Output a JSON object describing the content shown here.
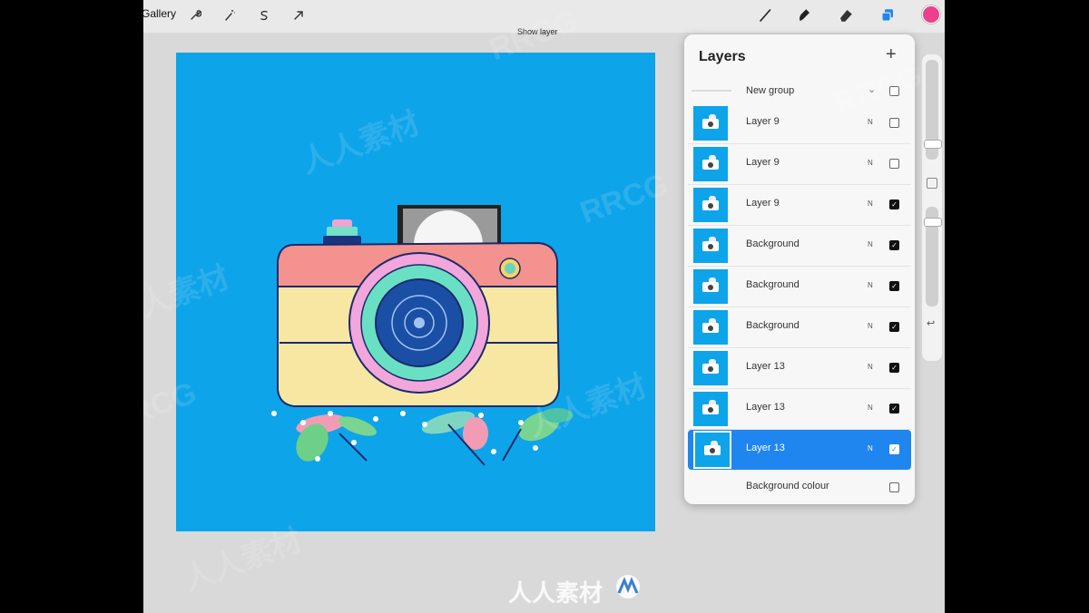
{
  "topbar": {
    "gallery_label": "Gallery",
    "tooltip": "Show layer",
    "left_tools": [
      "wrench-icon",
      "magic-wand-icon",
      "selection-icon",
      "transform-icon"
    ],
    "right_tools": [
      "brush-icon",
      "smudge-icon",
      "eraser-icon",
      "layers-icon"
    ],
    "current_color": "#ec3f8c",
    "accent_color": "#1e86ee"
  },
  "canvas": {
    "background_color": "#0ea4ea"
  },
  "layers_panel": {
    "title": "Layers",
    "add_label": "+",
    "group": {
      "name": "New group",
      "chevron": "⌄",
      "visible": false
    },
    "layers": [
      {
        "name": "Layer 9",
        "blend": "N",
        "visible": false,
        "selected": false
      },
      {
        "name": "Layer 9",
        "blend": "N",
        "visible": false,
        "selected": false
      },
      {
        "name": "Layer 9",
        "blend": "N",
        "visible": true,
        "selected": false
      },
      {
        "name": "Background",
        "blend": "N",
        "visible": true,
        "selected": false
      },
      {
        "name": "Background",
        "blend": "N",
        "visible": true,
        "selected": false
      },
      {
        "name": "Background",
        "blend": "N",
        "visible": true,
        "selected": false
      },
      {
        "name": "Layer 13",
        "blend": "N",
        "visible": true,
        "selected": false
      },
      {
        "name": "Layer 13",
        "blend": "N",
        "visible": true,
        "selected": false
      },
      {
        "name": "Layer 13",
        "blend": "N",
        "visible": true,
        "selected": true
      }
    ],
    "background_colour": {
      "name": "Background colour",
      "visible": false
    }
  },
  "sidebar": {
    "undo_label": "↩"
  },
  "watermarks": [
    "RRCG",
    "人人素材",
    "RRCG",
    "人人素材",
    "RRCG",
    "人人素材",
    "RRCG",
    "人人素材"
  ],
  "logo_text": "人人素材"
}
